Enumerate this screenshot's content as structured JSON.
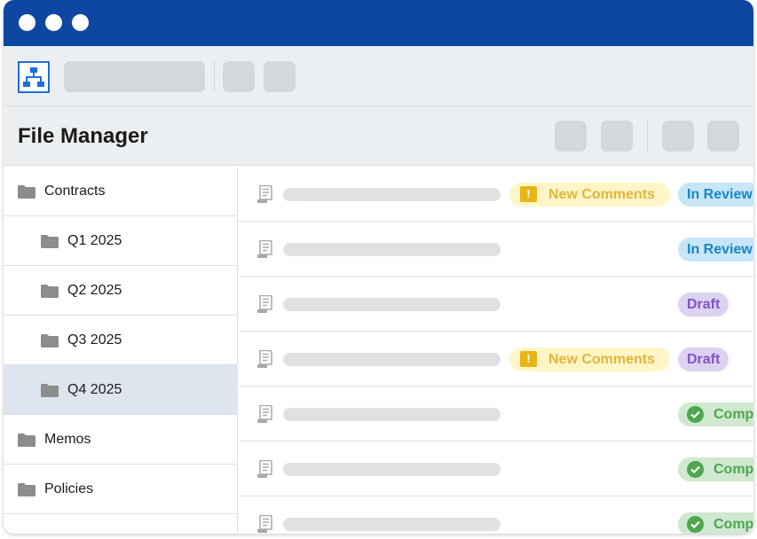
{
  "window": {
    "title_bar_color": "#0d47a1"
  },
  "header": {
    "page_title": "File Manager"
  },
  "sidebar": {
    "items": [
      {
        "label": "Contracts",
        "indent": 0,
        "selected": false,
        "icon": "folder-icon"
      },
      {
        "label": "Q1 2025",
        "indent": 1,
        "selected": false,
        "icon": "folder-icon"
      },
      {
        "label": "Q2 2025",
        "indent": 1,
        "selected": false,
        "icon": "folder-icon"
      },
      {
        "label": "Q3 2025",
        "indent": 1,
        "selected": false,
        "icon": "folder-icon"
      },
      {
        "label": "Q4 2025",
        "indent": 1,
        "selected": true,
        "icon": "folder-icon"
      },
      {
        "label": "Memos",
        "indent": 0,
        "selected": false,
        "icon": "folder-icon"
      },
      {
        "label": "Policies",
        "indent": 0,
        "selected": false,
        "icon": "folder-icon"
      }
    ]
  },
  "files": {
    "rows": [
      {
        "comment": "New Comments",
        "status": "In Review",
        "status_type": "review"
      },
      {
        "comment": "",
        "status": "In Review",
        "status_type": "review"
      },
      {
        "comment": "",
        "status": "Draft",
        "status_type": "draft"
      },
      {
        "comment": "New Comments",
        "status": "Draft",
        "status_type": "draft"
      },
      {
        "comment": "",
        "status": "Completed",
        "status_type": "complete"
      },
      {
        "comment": "",
        "status": "Completed",
        "status_type": "complete"
      },
      {
        "comment": "",
        "status": "Completed",
        "status_type": "complete"
      }
    ]
  },
  "colors": {
    "review": "#1a86c4",
    "draft": "#8054c5",
    "complete": "#4ea64e",
    "comment": "#e2b53a"
  }
}
